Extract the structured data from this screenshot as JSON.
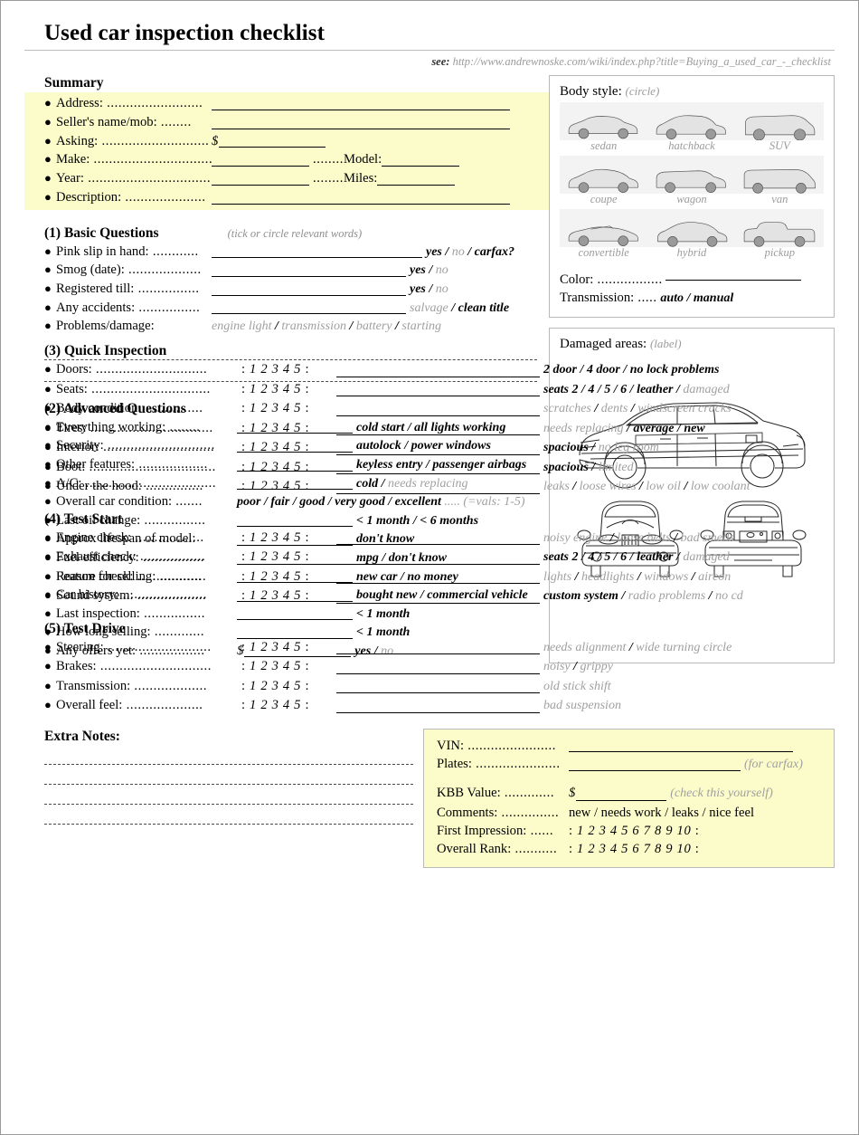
{
  "document": {
    "title": "Used car inspection checklist",
    "see_label": "see:",
    "see_url": "http://www.andrewnoske.com/wiki/index.php?title=Buying_a_used_car_-_checklist"
  },
  "summary": {
    "heading": "Summary",
    "rows": [
      {
        "label": "Address:",
        "dots": " ........................."
      },
      {
        "label": "Seller's name/mob:",
        "dots": " ........"
      },
      {
        "label": "Asking:",
        "dots": " ............................"
      },
      {
        "label": "Make:",
        "dots": " ..............................."
      },
      {
        "label": "Year:",
        "dots": " ................................."
      },
      {
        "label": "Description:",
        "dots": " ....................."
      }
    ],
    "money_symbol": "$",
    "model_label": "Model:",
    "miles_label": "Miles:",
    "mid_dots": "........"
  },
  "basic": {
    "heading": "(1) Basic Questions",
    "hint": "(tick or circle relevant words)",
    "rows": [
      {
        "label": "Pink slip in hand:",
        "dots": " ............",
        "options": "yes / no / carfax?"
      },
      {
        "label": "Smog (date):",
        "dots": " ...................",
        "options": "yes / no"
      },
      {
        "label": "Registered till:",
        "dots": " ................",
        "options": "yes / no"
      },
      {
        "label": "Any accidents:",
        "dots": " ................",
        "options": "salvage / clean title"
      },
      {
        "label": "Problems/damage:",
        "dots": "",
        "options": "engine light / transmission / battery / starting"
      }
    ]
  },
  "advanced": {
    "heading": "(2) Advanced Questions",
    "rows": [
      {
        "label": "Everything working:",
        "dots": " ........",
        "options": "cold start / all lights working"
      },
      {
        "label": "Security:",
        "dots": " ............................",
        "options": "autolock / power windows"
      },
      {
        "label": "Other features:",
        "dots": " ..................",
        "options": "keyless entry / passenger airbags"
      },
      {
        "label": "A/C:",
        "dots": " ..................................",
        "options": "cold / needs replacing"
      },
      {
        "label": "Overall car condition:",
        "dots": " .......",
        "options": "poor / fair / good / very good / excellent ..... (=vals: 1-5)"
      },
      {
        "label": "Last oil change:",
        "dots": " ................",
        "options": "< 1 month / < 6 months"
      },
      {
        "label": "Approx lifespan of model:",
        "dots": "",
        "options": "don't know"
      },
      {
        "label": "Fuel efficiency:",
        "dots": " ................",
        "options": "mpg / don't know"
      },
      {
        "label": "Reason for selling:",
        "dots": " ...........",
        "options": "new car / no money"
      },
      {
        "label": "Car history:",
        "dots": " ......................",
        "options": "bought new / commercial vehicle"
      },
      {
        "label": "Last inspection:",
        "dots": " ................",
        "options": "< 1 month"
      },
      {
        "label": "How long selling:",
        "dots": " .............",
        "options": "< 1 month"
      },
      {
        "label": "Any offers yet:",
        "dots": " .................",
        "options": "yes / no"
      }
    ]
  },
  "quick": {
    "heading": "(3) Quick Inspection",
    "scale": ": 1 2 3 4 5 :",
    "rows": [
      {
        "label": "Doors:",
        "dots": " .............................",
        "options": "2 door / 4 door / no lock problems"
      },
      {
        "label": "Seats:",
        "dots": " ...............................",
        "options": "seats 2 / 4 / 5 / 6 / leather / damaged"
      },
      {
        "label": "Body condition:",
        "dots": " ...............",
        "options": "scratches / dents / windscreen cracks"
      },
      {
        "label": "Tires:",
        "dots": " ................................",
        "options": "needs replacing / average / new"
      },
      {
        "label": "Interior:",
        "dots": " .............................",
        "options": "spacious / no leg room"
      },
      {
        "label": "Boot:",
        "dots": " .................................",
        "options": "spacious / limited"
      },
      {
        "label": "Under the hood:",
        "dots": " ...............",
        "options": "leaks / loose wires / low oil / low coolant"
      }
    ]
  },
  "test_start": {
    "heading": "(4) Test Start",
    "scale": ": 1 2 3 4 5 :",
    "rows": [
      {
        "label": "Engine check:",
        "dots": " ..................",
        "options": "noisy engine / loose belts / bad smells"
      },
      {
        "label": "Exhaust check:",
        "dots": " .................",
        "options": "seats 2 / 4 / 5 / 6 / leather / damaged"
      },
      {
        "label": "Feature check:",
        "dots": " ..................",
        "options": "lights / headlights / windows / aircon"
      },
      {
        "label": "Sound system:",
        "dots": "  ..................",
        "options": "custom system / radio problems / no cd"
      }
    ]
  },
  "test_drive": {
    "heading": "(5) Test Drive",
    "scale": ": 1 2 3 4 5 :",
    "rows": [
      {
        "label": "Steering:",
        "dots": " ...........................",
        "options": "needs alignment / wide turning circle"
      },
      {
        "label": "Brakes:",
        "dots": " .............................",
        "options": "noisy / grippy"
      },
      {
        "label": "Transmission:",
        "dots": " ...................",
        "options": "old stick shift"
      },
      {
        "label": "Overall feel:",
        "dots": "  ....................",
        "options": "bad suspension"
      }
    ]
  },
  "body_style": {
    "title": "Body style:",
    "hint": "(circle)",
    "styles": [
      "sedan",
      "hatchback",
      "SUV",
      "coupe",
      "wagon",
      "van",
      "convertible",
      "hybrid",
      "pickup"
    ],
    "color_label": "Color:",
    "color_dots": " .................",
    "transmission_label": "Transmission:",
    "transmission_dots": " .....",
    "transmission_options": "auto / manual"
  },
  "damaged": {
    "title": "Damaged areas:",
    "hint": "(label)"
  },
  "extra_notes": {
    "heading": "Extra Notes:",
    "line_count": 4
  },
  "vin_box": {
    "rows": [
      {
        "label": "VIN:",
        "dots": " ......................."
      },
      {
        "label": "Plates:",
        "dots": " ......................"
      },
      {
        "label": "KBB Value:",
        "dots": " ............."
      },
      {
        "label": "Comments:",
        "dots": " ..............."
      },
      {
        "label": "First Impression:",
        "dots": " ......"
      },
      {
        "label": "Overall Rank:",
        "dots": " ..........."
      }
    ],
    "plates_hint": "(for carfax)",
    "kbb_money": "$",
    "kbb_hint": "(check this yourself)",
    "comments_options": "new / needs work / leaks / nice feel",
    "rank_scale": ": 1 2 3 4 5 6 7 8 9 10 :"
  },
  "colors": {
    "summary_bg": "#fcfccb",
    "panel_border": "#b9b9b9",
    "grey_text": "#a0a0a0"
  }
}
